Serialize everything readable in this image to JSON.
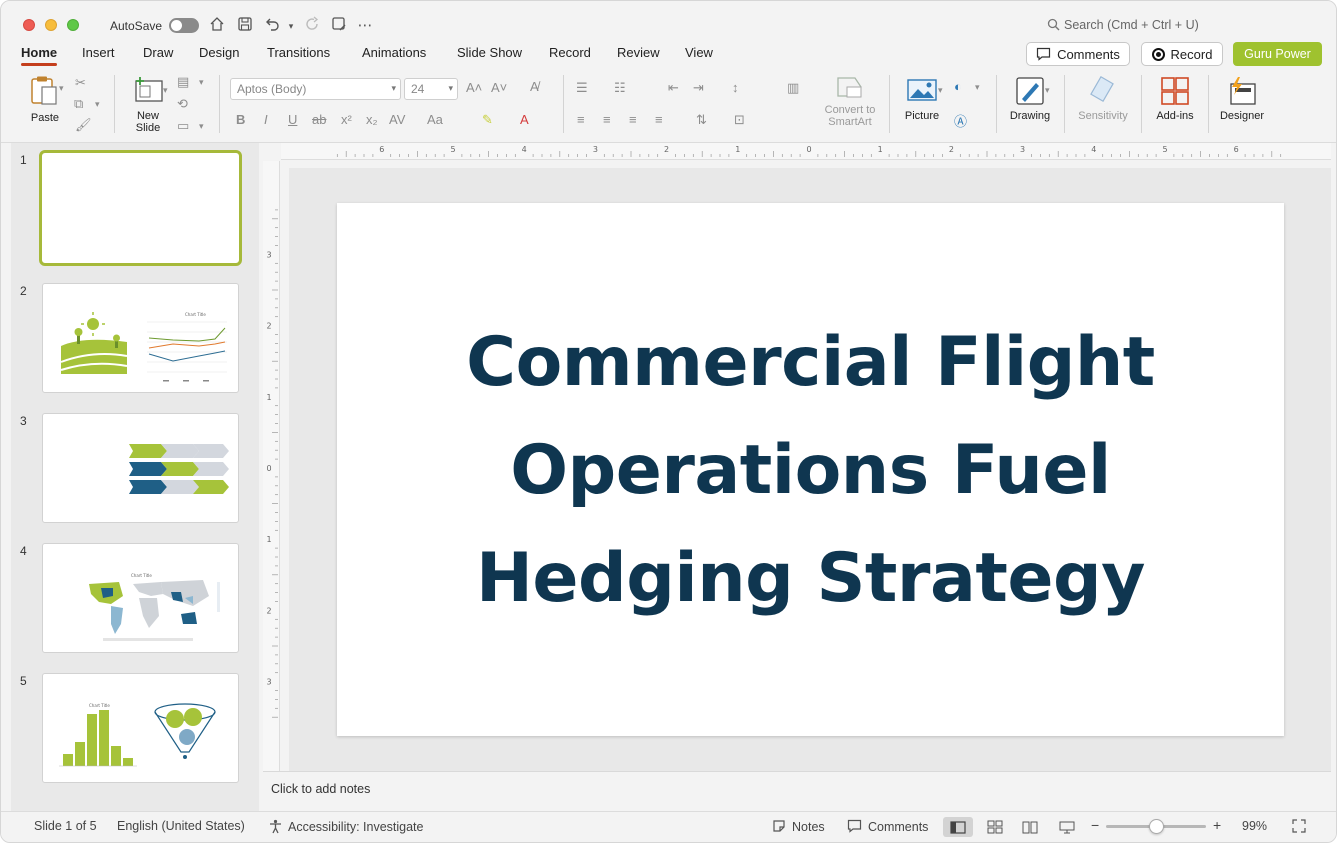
{
  "titlebar": {
    "autosave_label": "AutoSave",
    "search_placeholder": "Search (Cmd + Ctrl + U)"
  },
  "tabs": [
    {
      "label": "Home",
      "active": true
    },
    {
      "label": "Insert"
    },
    {
      "label": "Draw"
    },
    {
      "label": "Design"
    },
    {
      "label": "Transitions"
    },
    {
      "label": "Animations"
    },
    {
      "label": "Slide Show"
    },
    {
      "label": "Record"
    },
    {
      "label": "Review"
    },
    {
      "label": "View"
    }
  ],
  "header_buttons": {
    "comments": "Comments",
    "record": "Record",
    "guru": "Guru Power"
  },
  "ribbon": {
    "paste": "Paste",
    "new_slide_1": "New",
    "new_slide_2": "Slide",
    "font_name": "Aptos (Body)",
    "font_size": "24",
    "convert_1": "Convert to",
    "convert_2": "SmartArt",
    "picture": "Picture",
    "drawing": "Drawing",
    "sensitivity": "Sensitivity",
    "addins": "Add-ins",
    "designer": "Designer"
  },
  "slides_panel": {
    "numbers": [
      "1",
      "2",
      "3",
      "4",
      "5"
    ],
    "selected_index": 1
  },
  "slide": {
    "title_line1": "Commercial Flight",
    "title_line2": "Operations Fuel",
    "title_line3": "Hedging Strategy"
  },
  "notes_placeholder": "Click to add notes",
  "status": {
    "slide_counter": "Slide 1 of 5",
    "language": "English (United States)",
    "accessibility": "Accessibility: Investigate",
    "notes": "Notes",
    "comments": "Comments",
    "zoom": "99%",
    "zoom_level": 0.5
  },
  "colors": {
    "accent_red": "#c43e1c",
    "guru_green": "#9fc22f",
    "title_navy": "#0f3650",
    "thumb_green": "#a6c33a",
    "thumb_blue": "#1f5f86"
  },
  "icons": [
    "home-icon",
    "save-icon",
    "undo-icon",
    "redo-icon",
    "search-icon",
    "comment-icon",
    "record-icon"
  ]
}
